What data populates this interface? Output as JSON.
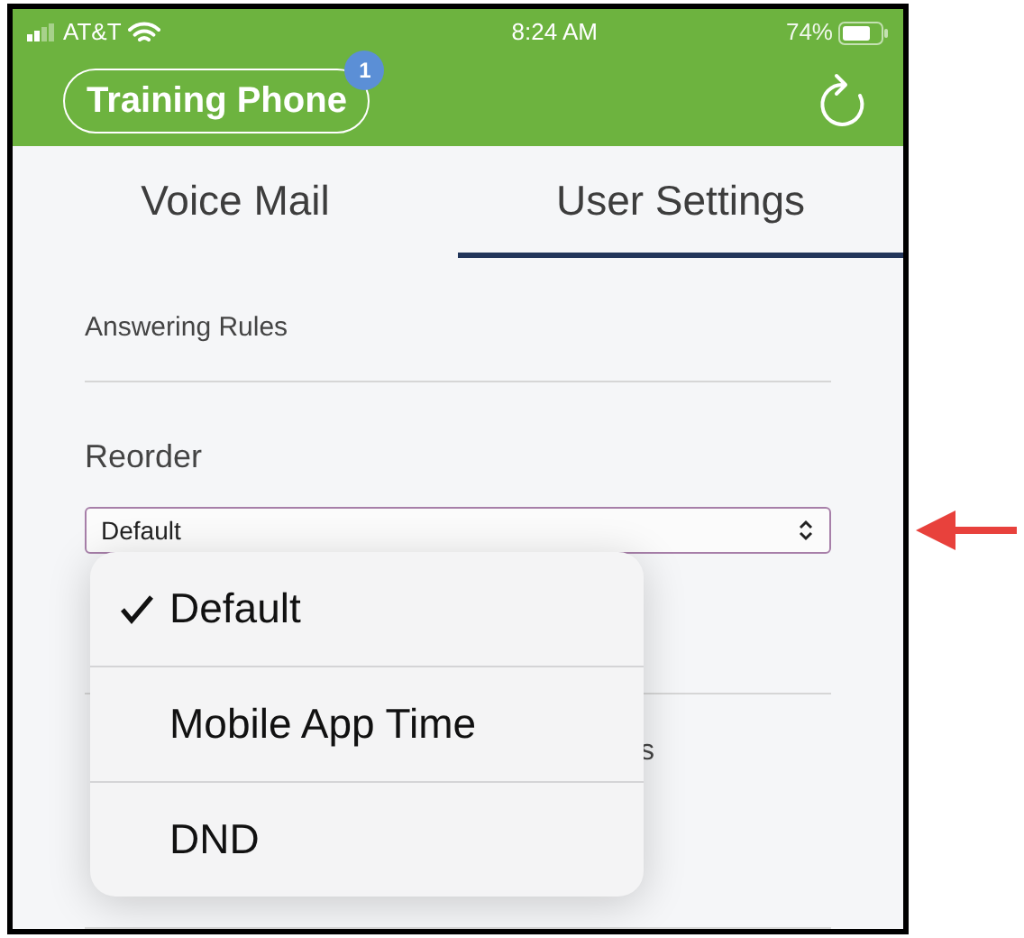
{
  "status_bar": {
    "carrier": "AT&T",
    "time": "8:24 AM",
    "battery": "74%"
  },
  "header": {
    "phone_button": "Training Phone",
    "badge": "1"
  },
  "tabs": [
    {
      "label": "Voice Mail",
      "selected": false
    },
    {
      "label": "User Settings",
      "selected": true
    }
  ],
  "settings": {
    "answering_rules": "Answering Rules",
    "reorder_label": "Reorder",
    "reorder_value": "Default",
    "covered_row_fragment": "s"
  },
  "dropdown_menu": [
    {
      "label": "Default",
      "selected": true
    },
    {
      "label": "Mobile App Time",
      "selected": false
    },
    {
      "label": "DND",
      "selected": false
    }
  ]
}
